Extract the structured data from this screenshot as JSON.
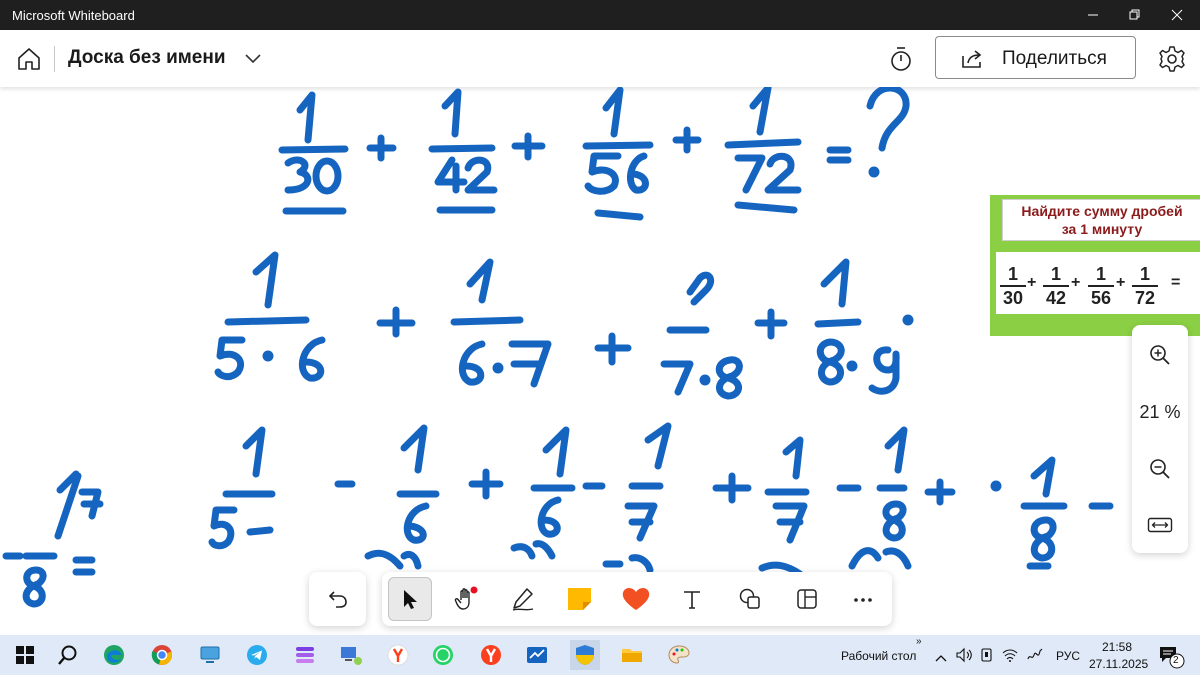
{
  "window": {
    "title": "Microsoft Whiteboard"
  },
  "app_bar": {
    "board_title": "Доска без имени",
    "share_label": "Поделиться"
  },
  "reference_card": {
    "heading_line1": "Найдите сумму дробей",
    "heading_line2": "за 1 минуту",
    "fractions": [
      {
        "num": "1",
        "den": "30"
      },
      {
        "num": "1",
        "den": "42"
      },
      {
        "num": "1",
        "den": "56"
      },
      {
        "num": "1",
        "den": "72"
      }
    ],
    "operator_plus": "+",
    "operator_equals": "="
  },
  "zoom": {
    "level": "21 %"
  },
  "toolbar": {
    "tools": [
      "undo-icon",
      "select-arrow-icon",
      "hand-icon",
      "pen-icon",
      "sticky-note-icon",
      "reaction-heart-icon",
      "text-icon",
      "shapes-icon",
      "template-icon",
      "more-icon"
    ],
    "active_tool": "select-arrow-icon",
    "ink_color": "#1565c0"
  },
  "taskbar": {
    "desktop_label": "Рабочий стол",
    "language": "РУС",
    "time": "21:58",
    "date": "27.11.2025",
    "notification_count": "2"
  }
}
